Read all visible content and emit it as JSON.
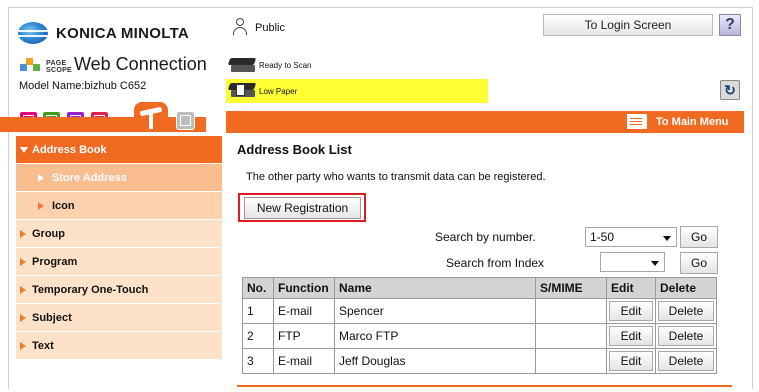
{
  "header": {
    "brand": "KONICA MINOLTA",
    "pagescope_word": "PAGE SCOPE",
    "product": "Web Connection",
    "model": "Model Name:bizhub C652",
    "user": "Public",
    "login_button": "To Login Screen",
    "help_button": "?",
    "refresh_icon": "refresh-icon"
  },
  "status": [
    {
      "text": "Ready to Scan",
      "icon": "scanner-icon"
    },
    {
      "text": "Low Paper",
      "icon": "low-paper-icon",
      "highlight": "#ffff33"
    }
  ],
  "tabs": [
    "information-tab",
    "job-tab",
    "box-tab",
    "direct-print-tab",
    "store-address-tab",
    "fax-tab"
  ],
  "main_menu": "To Main Menu",
  "sidebar": {
    "items": [
      {
        "label": "Address Book"
      },
      {
        "label": "Store Address"
      },
      {
        "label": "Icon"
      },
      {
        "label": "Group"
      },
      {
        "label": "Program"
      },
      {
        "label": "Temporary One-Touch"
      },
      {
        "label": "Subject"
      },
      {
        "label": "Text"
      }
    ]
  },
  "main": {
    "title": "Address Book List",
    "description": "The other party who wants to transmit data can be registered.",
    "new_registration": "New Registration",
    "search_number_label": "Search by number.",
    "search_number_value": "1-50",
    "search_index_label": "Search from Index",
    "search_index_value": "",
    "go": "Go"
  },
  "table": {
    "headers": [
      "No.",
      "Function",
      "Name",
      "S/MIME",
      "Edit",
      "Delete"
    ],
    "rows": [
      {
        "no": "1",
        "function": "E-mail",
        "name": "Spencer",
        "smime": "",
        "edit": "Edit",
        "delete": "Delete"
      },
      {
        "no": "2",
        "function": "FTP",
        "name": "Marco FTP",
        "smime": "",
        "edit": "Edit",
        "delete": "Delete"
      },
      {
        "no": "3",
        "function": "E-mail",
        "name": "Jeff Douglas",
        "smime": "",
        "edit": "Edit",
        "delete": "Delete"
      }
    ]
  },
  "colors": {
    "accent": "#f06a22",
    "sidebar_light": "#fde2c9",
    "highlight_box": "#e21b23"
  }
}
